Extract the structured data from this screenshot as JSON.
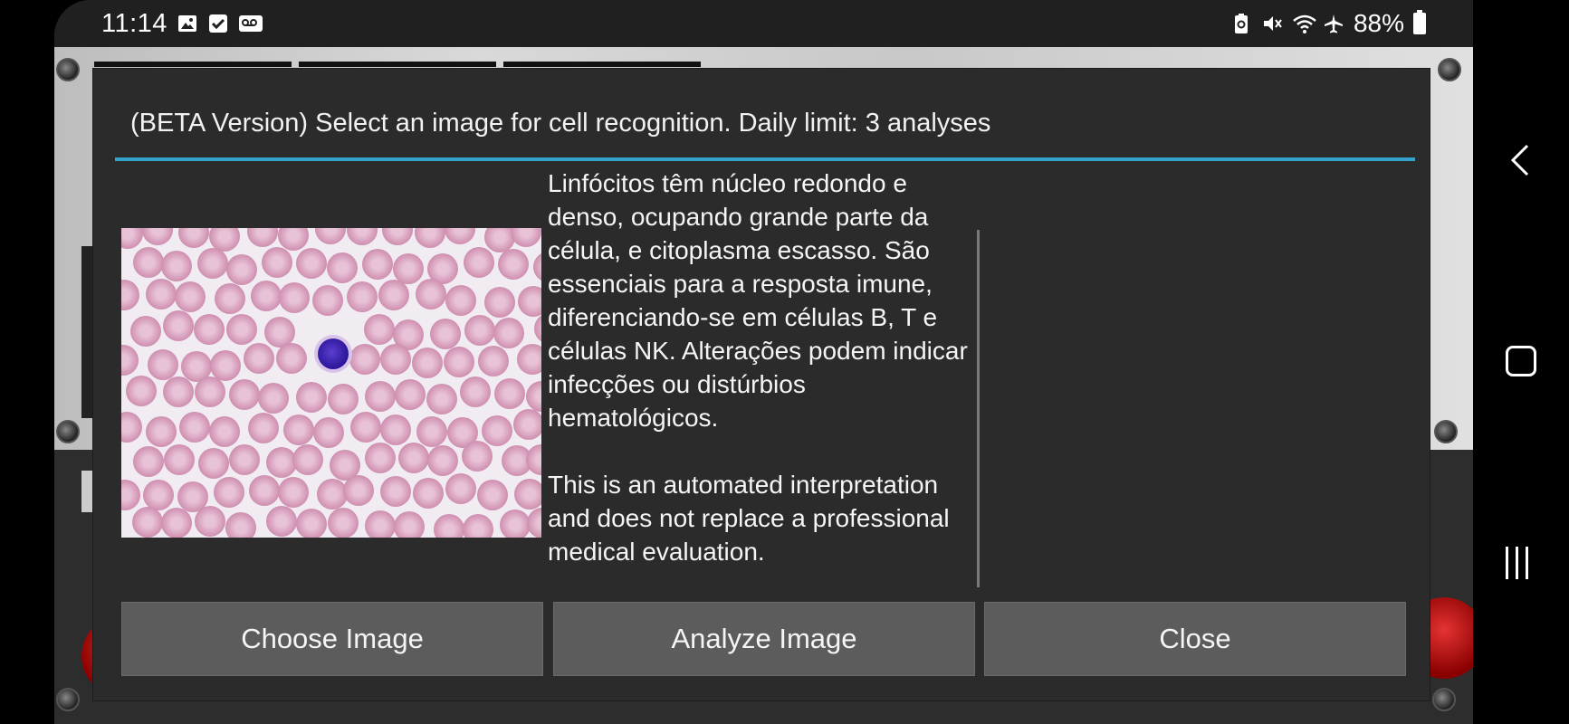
{
  "status_bar": {
    "time": "11:14",
    "battery": "88%",
    "left_icons": [
      "image-icon",
      "checkbox-icon",
      "voicemail-icon"
    ],
    "right_icons": [
      "battery-saver-icon",
      "mute-icon",
      "wifi-icon",
      "airplane-icon"
    ]
  },
  "dialog": {
    "title": "(BETA Version) Select an image for cell recognition. Daily limit: 3 analyses",
    "accent_color": "#33a2cc",
    "description": "Linfócitos têm núcleo redondo e denso, ocupando grande parte da célula, e citoplasma escasso. São essenciais para a resposta imune, diferenciando-se em células B, T e células NK. Alterações podem indicar infecções ou distúrbios hematológicos.",
    "disclaimer": "This is an automated interpretation and does not replace a professional medical evaluation.",
    "buttons": {
      "choose": "Choose Image",
      "analyze": "Analyze Image",
      "close": "Close"
    }
  },
  "nav": {
    "icons": [
      "back-icon",
      "home-icon",
      "recents-icon"
    ]
  }
}
